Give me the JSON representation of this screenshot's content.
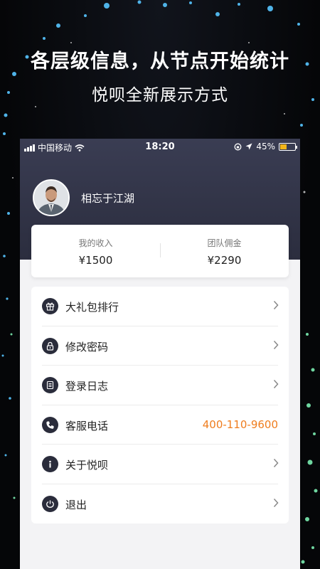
{
  "promo": {
    "headline": "各层级信息，从节点开始统计",
    "subline": "悦呗全新展示方式"
  },
  "statusbar": {
    "carrier": "中国移动",
    "time": "18:20",
    "battery": "45%",
    "battery_level": 0.45
  },
  "profile": {
    "username": "相忘于江湖"
  },
  "income": {
    "my_income_label": "我的收入",
    "my_income_value": "¥1500",
    "team_label": "团队佣金",
    "team_value": "¥2290"
  },
  "menu": {
    "items": [
      {
        "label": "大礼包排行",
        "icon": "gift-icon"
      },
      {
        "label": "修改密码",
        "icon": "lock-icon"
      },
      {
        "label": "登录日志",
        "icon": "log-icon"
      },
      {
        "label": "客服电话",
        "icon": "phone-icon",
        "value": "400-110-9600"
      },
      {
        "label": "关于悦呗",
        "icon": "info-icon"
      },
      {
        "label": "退出",
        "icon": "power-icon"
      }
    ]
  },
  "colors": {
    "header_bg": "#33364a",
    "accent_orange": "#ef7d1e",
    "icon_bg": "#2a2c3b"
  }
}
